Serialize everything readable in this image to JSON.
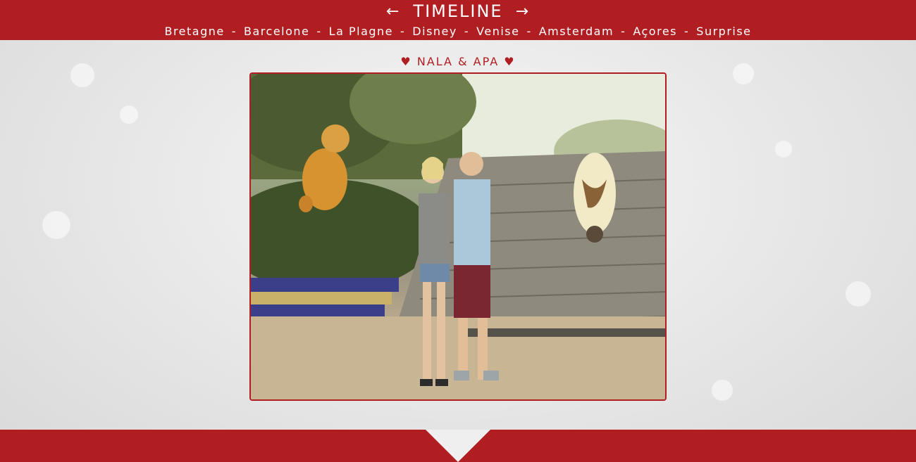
{
  "header": {
    "prev_arrow": "←",
    "title": "TIMELINE",
    "next_arrow": "→",
    "nav": [
      {
        "label": "Bretagne"
      },
      {
        "label": "Barcelone"
      },
      {
        "label": "La Plagne"
      },
      {
        "label": "Disney"
      },
      {
        "label": "Venise"
      },
      {
        "label": "Amsterdam"
      },
      {
        "label": "Açores"
      },
      {
        "label": "Surprise"
      }
    ],
    "separator": "-"
  },
  "caption": "♥ NALA & APA ♥",
  "colors": {
    "accent": "#b01e22",
    "background": "#e9e9e9"
  },
  "photo": {
    "alt": "Couple on stairs with cartoon lioness and flying bison"
  }
}
